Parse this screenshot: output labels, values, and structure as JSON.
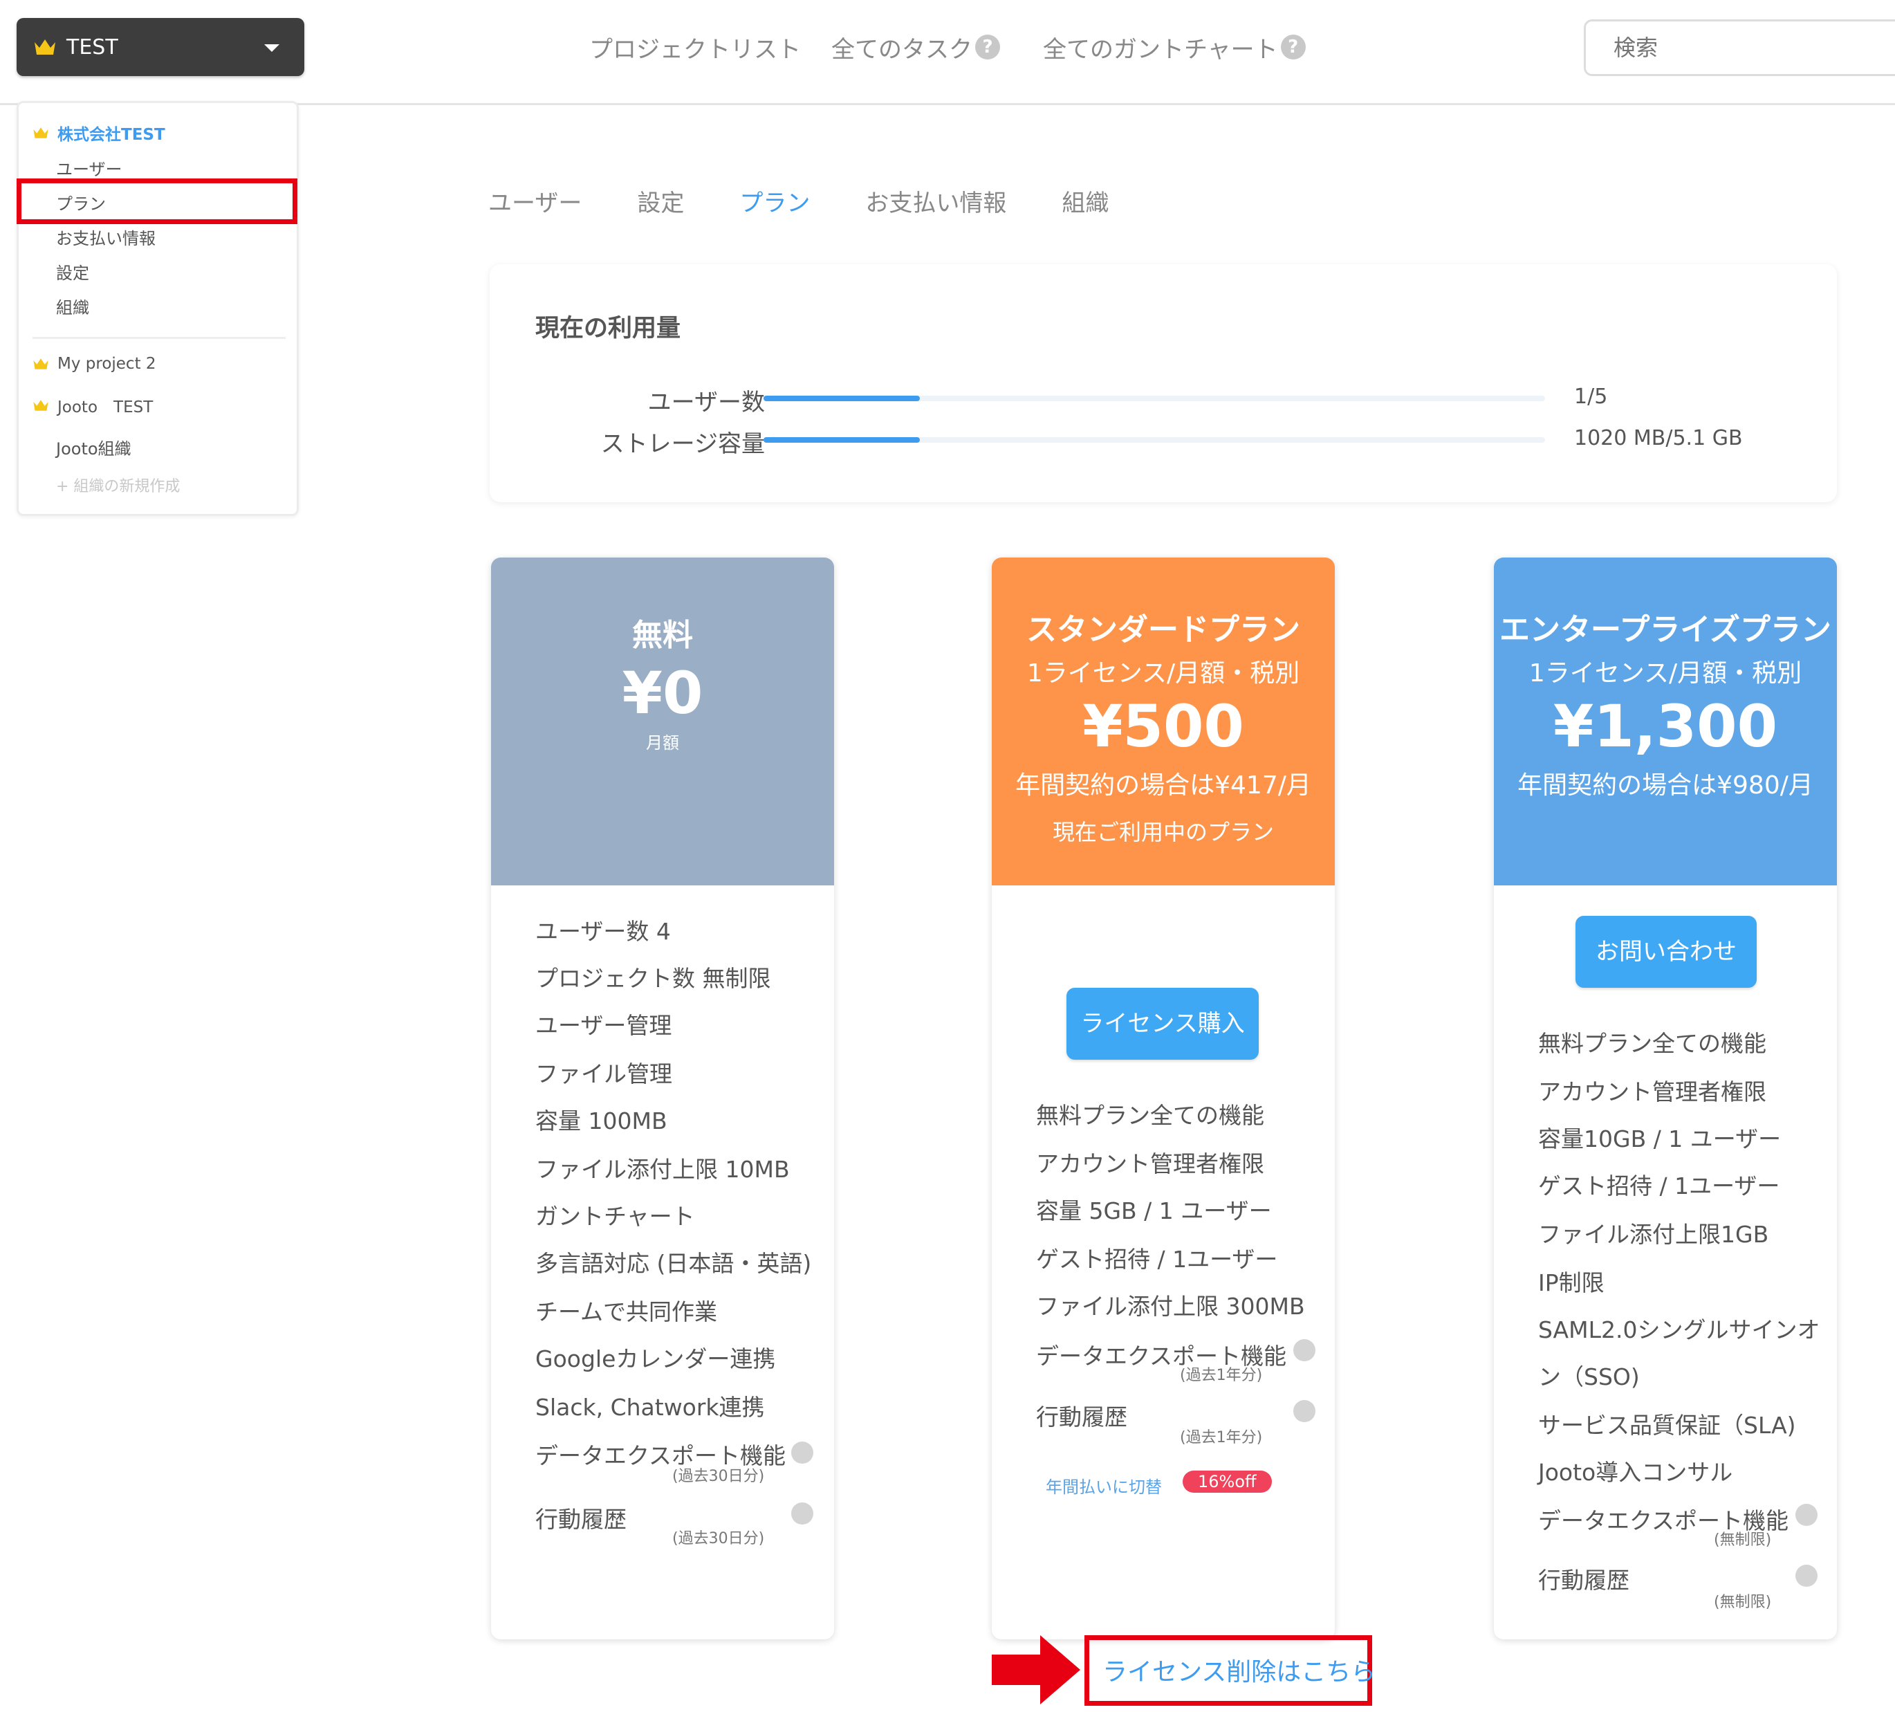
{
  "workspace": {
    "name": "TEST"
  },
  "topnav": {
    "project_list": "プロジェクトリスト",
    "all_tasks": "全てのタスク",
    "all_gantt": "全てのガントチャート",
    "help": "?",
    "search_placeholder": "検索"
  },
  "sidebar": {
    "org_name": "株式会社TEST",
    "items": [
      "ユーザー",
      "プラン",
      "お支払い情報",
      "設定",
      "組織"
    ],
    "projects": [
      "My project 2",
      "Jooto　TEST"
    ],
    "org2": "Jooto組織",
    "new_org": "+ 組織の新規作成"
  },
  "tabs": [
    "ユーザー",
    "設定",
    "プラン",
    "お支払い情報",
    "組織"
  ],
  "usage": {
    "title": "現在の利用量",
    "rows": [
      {
        "label": "ユーザー数",
        "value": "1/5",
        "fraction": 0.2
      },
      {
        "label": "ストレージ容量",
        "value": "1020 MB/5.1 GB",
        "fraction": 0.2
      }
    ]
  },
  "plans": {
    "free": {
      "title": "無料",
      "price": "¥0",
      "period": "月額",
      "features": [
        "ユーザー数 4",
        "プロジェクト数 無制限",
        "ユーザー管理",
        "ファイル管理",
        "容量 100MB",
        "ファイル添付上限 10MB",
        "ガントチャート",
        "多言語対応 (日本語・英語)",
        "チームで共同作業",
        "Googleカレンダー連携",
        "Slack, Chatwork連携",
        "データエクスポート機能",
        "行動履歴"
      ],
      "export_note": "(過去30日分)",
      "history_note": "(過去30日分)"
    },
    "standard": {
      "title": "スタンダードプラン",
      "sub": "1ライセンス/月額・税別",
      "price": "¥500",
      "yearly": "年間契約の場合は¥417/月",
      "current": "現在ご利用中のプラン",
      "toggle": "年間払いに切替",
      "badge": "16%off",
      "button": "ライセンス購入",
      "features": [
        "無料プラン全ての機能",
        "アカウント管理者権限",
        "容量 5GB / 1 ユーザー",
        "ゲスト招待 / 1ユーザー",
        "ファイル添付上限 300MB",
        "データエクスポート機能",
        "行動履歴"
      ],
      "export_note": "(過去1年分)",
      "history_note": "(過去1年分)"
    },
    "enterprise": {
      "title": "エンタープライズプラン",
      "sub": "1ライセンス/月額・税別",
      "price": "¥1,300",
      "yearly": "年間契約の場合は¥980/月",
      "button": "お問い合わせ",
      "features": [
        "無料プラン全ての機能",
        "アカウント管理者権限",
        "容量10GB / 1 ユーザー",
        "ゲスト招待 / 1ユーザー",
        "ファイル添付上限1GB",
        "IP制限",
        "SAML2.0シングルサインオ",
        "ン（SSO)",
        "サービス品質保証（SLA)",
        "Jooto導入コンサル",
        "データエクスポート機能",
        "行動履歴"
      ],
      "export_note": "(無制限)",
      "history_note": "(無制限)"
    }
  },
  "delete_license_link": "ライセンス削除はこちら",
  "colors": {
    "accent": "#3d9bf0",
    "highlight": "#e60012",
    "standard": "#fd944a",
    "enterprise": "#5ea6e8",
    "free": "#9aafc6"
  }
}
